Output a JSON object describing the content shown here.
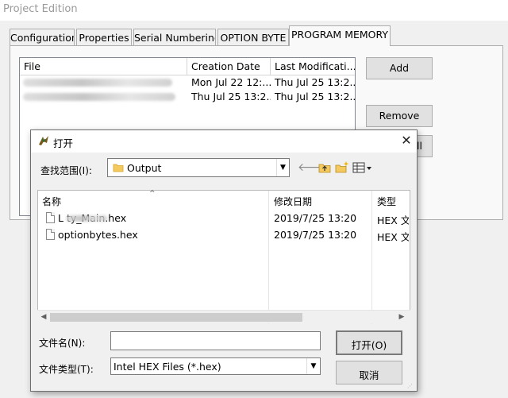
{
  "window": {
    "title": "Project Edition"
  },
  "tabs": [
    {
      "label": "Configuration"
    },
    {
      "label": "Properties"
    },
    {
      "label": "Serial Numbering"
    },
    {
      "label": "OPTION BYTE"
    },
    {
      "label": "PROGRAM MEMORY"
    }
  ],
  "file_list": {
    "columns": [
      "File",
      "Creation Date",
      "Last Modificati..."
    ],
    "rows": [
      {
        "file": "",
        "creation": "Mon Jul 22 12:...",
        "modified": "Thu Jul 25 13:2..."
      },
      {
        "file": "",
        "creation": "Thu Jul 25 13:2...",
        "modified": "Thu Jul 25 13:2..."
      }
    ]
  },
  "buttons": {
    "add": "Add",
    "remove": "Remove",
    "all": "All"
  },
  "dialog": {
    "title": "打开",
    "look_in_label": "查找范围(I):",
    "look_in_value": "Output",
    "columns": [
      "名称",
      "修改日期",
      "类型"
    ],
    "files": [
      {
        "name": "L          ty_Main.hex",
        "date": "2019/7/25 13:20",
        "type": "HEX 文"
      },
      {
        "name": "optionbytes.hex",
        "date": "2019/7/25 13:20",
        "type": "HEX 文"
      }
    ],
    "filename_label": "文件名(N):",
    "filename_value": "",
    "filetype_label": "文件类型(T):",
    "filetype_value": "Intel HEX Files (*.hex)",
    "open_button": "打开(O)",
    "cancel_button": "取消"
  },
  "icons": {
    "close": "close-icon",
    "back": "back-arrow-icon",
    "up": "up-folder-icon",
    "new_folder": "new-folder-icon",
    "view": "view-menu-icon",
    "folder": "folder-icon"
  }
}
